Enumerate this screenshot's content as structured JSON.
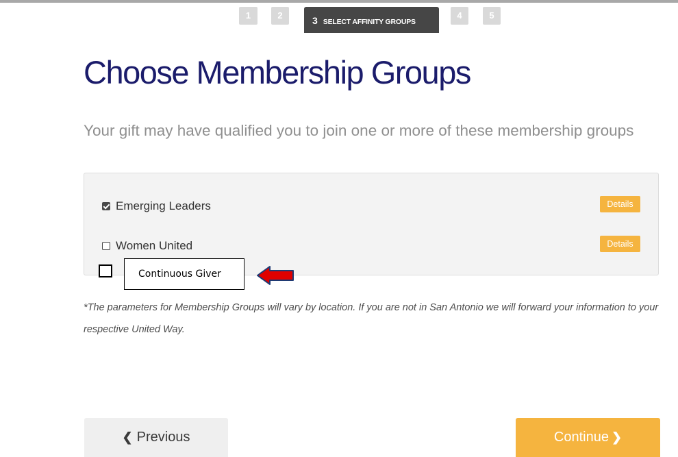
{
  "progress": {
    "steps": [
      {
        "number": "1",
        "label": ""
      },
      {
        "number": "2",
        "label": ""
      },
      {
        "number": "3",
        "label": "SELECT AFFINITY GROUPS"
      },
      {
        "number": "4",
        "label": ""
      },
      {
        "number": "5",
        "label": ""
      }
    ],
    "current_step": 3
  },
  "page": {
    "title": "Choose Membership Groups",
    "subtitle": "Your gift may have qualified you to join one or more of these membership groups"
  },
  "groups": [
    {
      "label": "Emerging Leaders",
      "checked": true,
      "details_label": "Details"
    },
    {
      "label": "Women United",
      "checked": false,
      "details_label": "Details"
    }
  ],
  "annotation": {
    "checkbox_checked": false,
    "text": "Continuous Giver",
    "arrow_color": "#e00000"
  },
  "footnote": "*The parameters for Membership Groups will vary by location. If you are not in San Antonio we will forward your information to your respective United Way.",
  "nav": {
    "previous_label": "Previous",
    "continue_label": "Continue"
  },
  "colors": {
    "title": "#1b1c6b",
    "accent": "#f5b43f",
    "active_step": "#464646",
    "inactive_step": "#d9d9d9"
  },
  "icons": {
    "previous": "chevron-left-icon",
    "continue": "chevron-right-icon",
    "annotation_arrow": "arrow-left-icon"
  }
}
